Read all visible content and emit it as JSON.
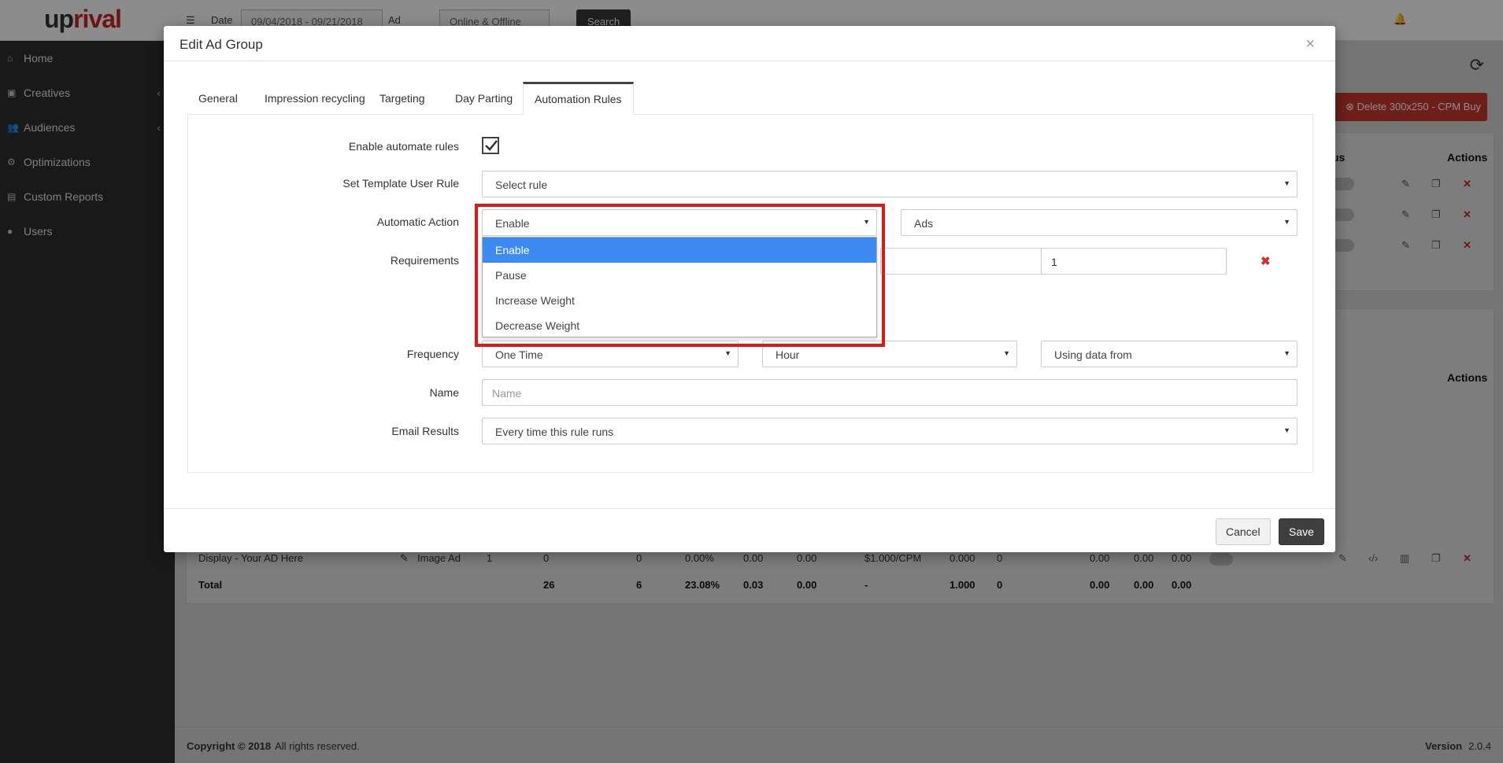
{
  "app": {
    "logo_part1": "up",
    "logo_part2": "rival",
    "nav": [
      {
        "label": "Home",
        "icon": "home-icon",
        "glyph": "⌂",
        "caret": false
      },
      {
        "label": "Creatives",
        "icon": "image-icon",
        "glyph": "▣",
        "caret": true
      },
      {
        "label": "Audiences",
        "icon": "users-icon",
        "glyph": "👥",
        "caret": true
      },
      {
        "label": "Optimizations",
        "icon": "cogs-icon",
        "glyph": "⚙",
        "caret": false
      },
      {
        "label": "Custom Reports",
        "icon": "file-icon",
        "glyph": "▤",
        "caret": false
      },
      {
        "label": "Users",
        "icon": "user-icon",
        "glyph": "●",
        "caret": false
      }
    ],
    "filters": {
      "date_label": "Date",
      "date_value": "09/04/2018 - 09/21/2018",
      "status_label": "Ad Status",
      "status_value": "Online & Offline",
      "search_label": "Search"
    },
    "delete_button_label": "Delete 300x250 - CPM Buy",
    "status_col_partial": "us",
    "actions_header": "Actions",
    "last_row": {
      "name": "Display - Your AD Here",
      "type": "Image Ad",
      "c1": "1",
      "c2": "0",
      "c3": "0",
      "c4": "0.00%",
      "c5": "0.00",
      "c6": "0.00",
      "c7": "$1.000/CPM",
      "c8": "0.000",
      "c9": "0",
      "c10": "0.00",
      "c11": "0.00",
      "c12": "0.00"
    },
    "total_row": {
      "label": "Total",
      "c2": "26",
      "c3": "6",
      "c4": "23.08%",
      "c5": "0.03",
      "c6": "0.00",
      "c7": "-",
      "c8": "1.000",
      "c9": "0",
      "c10": "0.00",
      "c11": "0.00",
      "c12": "0.00"
    },
    "footer": {
      "copyright": "Copyright © 2018",
      "rights": "All rights reserved.",
      "version_label": "Version",
      "version": "2.0.4"
    }
  },
  "modal": {
    "title": "Edit Ad Group",
    "close_glyph": "×",
    "tabs": [
      "General",
      "Impression recycling",
      "Targeting",
      "Day Parting",
      "Automation Rules"
    ],
    "active_tab": "Automation Rules",
    "form": {
      "enable_label": "Enable automate rules",
      "enable_checked": true,
      "template_label": "Set Template User Rule",
      "template_value": "Select rule",
      "action_label": "Automatic Action",
      "action_value": "Enable",
      "action_target_value": "Ads",
      "requirements_label": "Requirements",
      "requirements_value": "1",
      "frequency_label": "Frequency",
      "frequency_value": "One Time",
      "frequency_unit": "Hour",
      "frequency_data": "Using data from",
      "name_label": "Name",
      "name_placeholder": "Name",
      "email_label": "Email Results",
      "email_value": "Every time this rule runs"
    },
    "dropdown_options": [
      "Enable",
      "Pause",
      "Increase Weight",
      "Decrease Weight"
    ],
    "dropdown_selected": "Enable",
    "cancel_label": "Cancel",
    "save_label": "Save"
  },
  "colors": {
    "brand_red": "#c9252b",
    "selected_blue": "#3c8bf2",
    "highlight_red": "#e01717"
  }
}
